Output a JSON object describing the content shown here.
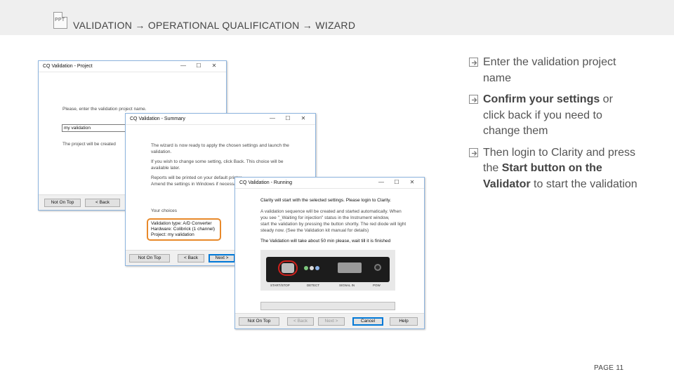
{
  "header": {
    "icon_label": "PPT",
    "breadcrumb": "VALIDATION → OPERATIONAL QUALIFICATION → WIZARD"
  },
  "dialogs": {
    "project": {
      "title": "CQ Validation - Project",
      "controls": [
        "—",
        "☐",
        "✕"
      ],
      "prompt": "Please, enter the validation project name.",
      "input_value": "my validation",
      "note": "The project will be created",
      "buttons": {
        "not_on_top": "Not On Top",
        "back": "< Back"
      }
    },
    "summary": {
      "title": "CQ Validation - Summary",
      "controls": [
        "—",
        "☐",
        "✕"
      ],
      "line1": "The wizard is now ready to apply the chosen settings and launch the",
      "line2": "validation.",
      "line3": "If you wish to change some setting, click Back. This choice will be",
      "line4": "available later.",
      "line5": "Reports will be printed on your default printer.",
      "line6": "Amend the settings in Windows if necessary.",
      "choices_label": "Your choices",
      "choices": [
        "Validation type: A/D Converter",
        "Hardware: Colibrick (1 channel)",
        "Project: my validation"
      ],
      "buttons": {
        "not_on_top": "Not On Top",
        "back": "< Back",
        "next": "Next >"
      }
    },
    "running": {
      "title": "CQ Validation - Running",
      "controls": [
        "—",
        "☐",
        "✕"
      ],
      "line1": "Clarity will start with the selected settings. Please login to Clarity.",
      "line2": "A validation sequence will be created and started automatically. When",
      "line3": "you see \"_Waiting for injection\" status in the Instrument window,",
      "line4": "start the validation by pressing the button shortly. The red diode will light",
      "line5": "steady now. (See the Validation kit manual for details)",
      "duration": "The Validation will take about 50 min please, wait till it is finished",
      "device_labels": [
        "START/STOP",
        "DETECT",
        "SIGNAL IN",
        "POW"
      ],
      "buttons": {
        "not_on_top": "Not On Top",
        "back": "< Back",
        "next": "Next >",
        "cancel": "Cancel",
        "help": "Help"
      }
    }
  },
  "bullets": [
    {
      "plain_before": "Enter the validation project name",
      "bold": "",
      "plain_after": ""
    },
    {
      "plain_before": "",
      "bold": "Confirm your settings",
      "plain_after": " or click back if you need to change them"
    },
    {
      "plain_before": "Then login to Clarity and press the ",
      "bold": "Start button on the Validator",
      "plain_after": " to start the validation"
    }
  ],
  "footer": {
    "page": "PAGE 11"
  },
  "colors": {
    "highlight_orange": "#e8892a",
    "highlight_red": "#d0201c",
    "window_border": "#8db4de",
    "primary_button": "#0078d7"
  }
}
